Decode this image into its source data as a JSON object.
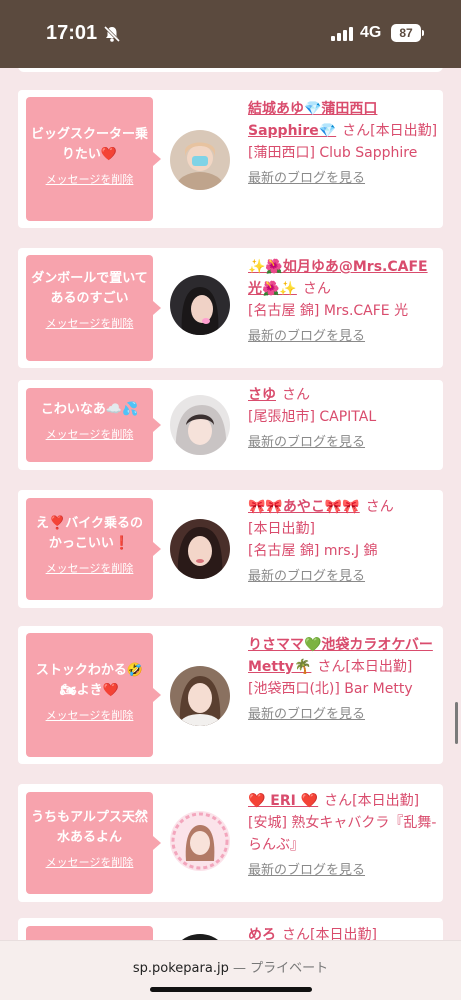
{
  "status_bar": {
    "time": "17:01",
    "network": "4G",
    "battery": "87"
  },
  "common": {
    "san": "さん",
    "delete_label": "メッセージを削除",
    "blog_label": "最新のブログを見る"
  },
  "cards": [
    {
      "message": "ビッグスクーター乗りたい❤️",
      "name": "結城あゆ💎蒲田西口Sapphire💎",
      "status": "[本日出勤]",
      "shop": "[蒲田西口] Club Sapphire"
    },
    {
      "message": "ダンボールで置いてあるのすごい",
      "name": "✨🌺如月ゆあ@Mrs.CAFE光🌺✨",
      "status": "",
      "shop": "[名古屋 錦] Mrs.CAFE 光"
    },
    {
      "message": "こわいなあ☁️💦",
      "name": "さゆ",
      "status": "",
      "shop": "[尾張旭市] CAPITAL"
    },
    {
      "message": "え❣️バイク乗るのかっこいい❗️",
      "name": "🎀🎀あやこ🎀🎀",
      "status": "[本日出勤]",
      "shop": "[名古屋 錦] mrs.J 錦"
    },
    {
      "message": "ストックわかる🤣🏍よき❤️",
      "name": "りさママ💚池袋カラオケバーMetty🌴",
      "status": "[本日出勤]",
      "shop": "[池袋西口(北)] Bar Metty"
    },
    {
      "message": "うちもアルプス天然水あるよん",
      "name": "❤️ ERI ❤️",
      "status": "[本日出勤]",
      "shop": "[安城] 熟女キャバクラ『乱舞-らんぶ』"
    },
    {
      "message": "",
      "name": "めろ",
      "status": "[本日出勤]",
      "shop": ""
    }
  ],
  "bottom_bar": {
    "domain": "sp.pokepara.jp",
    "separator": "—",
    "mode": "プライベート"
  }
}
